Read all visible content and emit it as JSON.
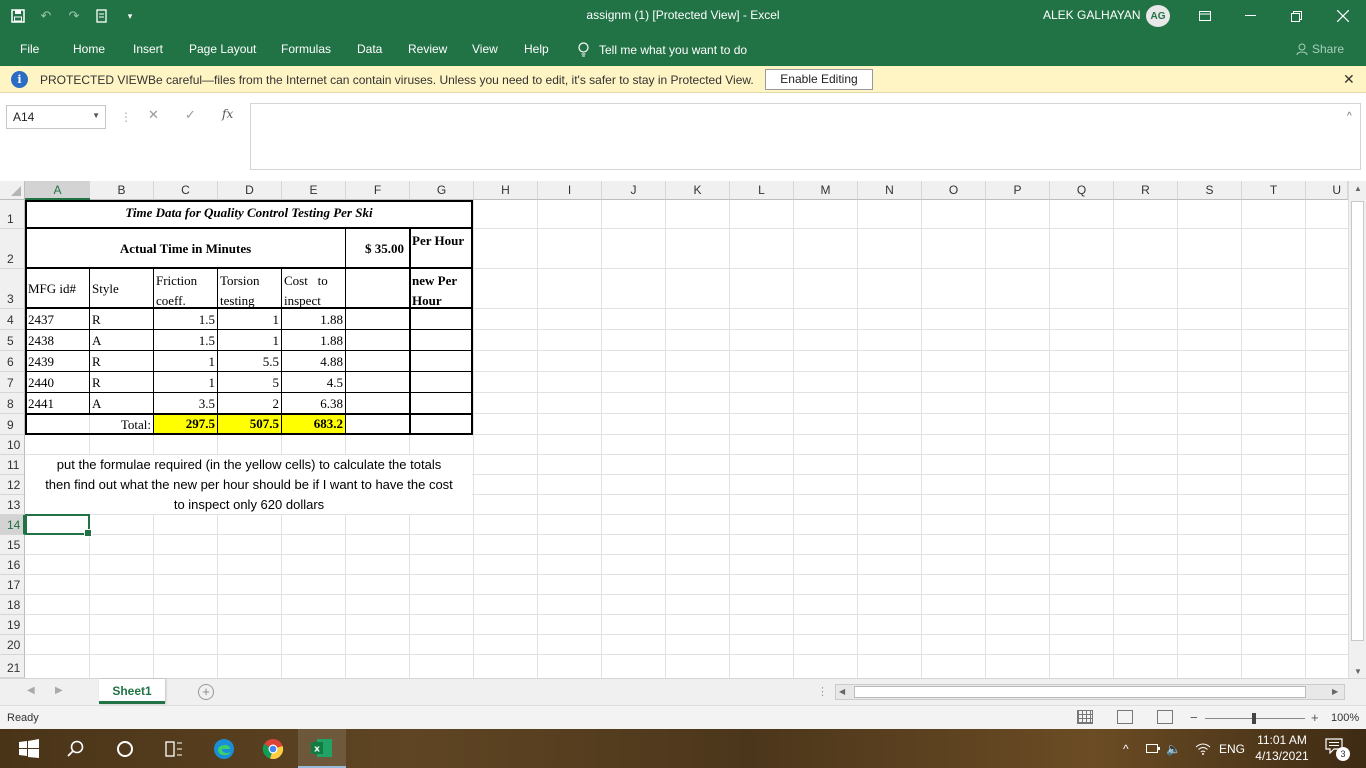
{
  "window": {
    "title": "assignm (1)  [Protected View]  -  Excel",
    "user_name": "ALEK GALHAYAN",
    "user_initials": "AG"
  },
  "ribbon": {
    "tabs": [
      "File",
      "Home",
      "Insert",
      "Page Layout",
      "Formulas",
      "Data",
      "Review",
      "View",
      "Help"
    ],
    "tell_me": "Tell me what you want to do",
    "share": "Share"
  },
  "protected_view": {
    "title": "PROTECTED VIEW",
    "message": "Be careful—files from the Internet can contain viruses. Unless you need to edit, it's safer to stay in Protected View.",
    "button": "Enable Editing"
  },
  "formula_bar": {
    "name_box": "A14",
    "fx": "fx",
    "value": ""
  },
  "columns": [
    "A",
    "B",
    "C",
    "D",
    "E",
    "F",
    "G",
    "H",
    "I",
    "J",
    "K",
    "L",
    "M",
    "N",
    "O",
    "P",
    "Q",
    "R",
    "S",
    "T",
    "U"
  ],
  "rows": [
    "1",
    "2",
    "3",
    "4",
    "5",
    "6",
    "7",
    "8",
    "9",
    "10",
    "11",
    "12",
    "13",
    "14",
    "15",
    "16",
    "17",
    "18",
    "19",
    "20",
    "21"
  ],
  "sheet": {
    "title": "Time Data for Quality Control Testing Per Ski",
    "actual_time": "Actual Time in Minutes",
    "rate": "$ 35.00",
    "per_hour": "Per Hour",
    "new_per_hour": "new Per Hour",
    "headers": {
      "mfg": "MFG id#",
      "style": "Style",
      "friction": "Friction coeff.",
      "torsion": "Torsion testing",
      "cost": "Cost   to inspect"
    },
    "data_rows": [
      {
        "id": "2437",
        "style": "R",
        "friction": "1.5",
        "torsion": "1",
        "cost": "1.88"
      },
      {
        "id": "2438",
        "style": "A",
        "friction": "1.5",
        "torsion": "1",
        "cost": "1.88"
      },
      {
        "id": "2439",
        "style": "R",
        "friction": "1",
        "torsion": "5.5",
        "cost": "4.88"
      },
      {
        "id": "2440",
        "style": "R",
        "friction": "1",
        "torsion": "5",
        "cost": "4.5"
      },
      {
        "id": "2441",
        "style": "A",
        "friction": "3.5",
        "torsion": "2",
        "cost": "6.38"
      }
    ],
    "total_label": "Total:",
    "totals": {
      "friction": "297.5",
      "torsion": "507.5",
      "cost": "683.2"
    },
    "note_line1": "put the formulae required (in the yellow cells) to calculate the totals",
    "note_line2": "then find out what the new per hour should be if I want to have the cost",
    "note_line3": "to inspect only 620 dollars"
  },
  "sheet_tabs": [
    "Sheet1"
  ],
  "status": {
    "ready": "Ready",
    "zoom": "100%"
  },
  "taskbar": {
    "language": "ENG",
    "time": "11:01 AM",
    "date": "4/13/2021",
    "notifications": "3"
  },
  "colors": {
    "excel_green": "#217346",
    "highlight_yellow": "#ffff00",
    "protected_bar": "#fff4c4"
  }
}
